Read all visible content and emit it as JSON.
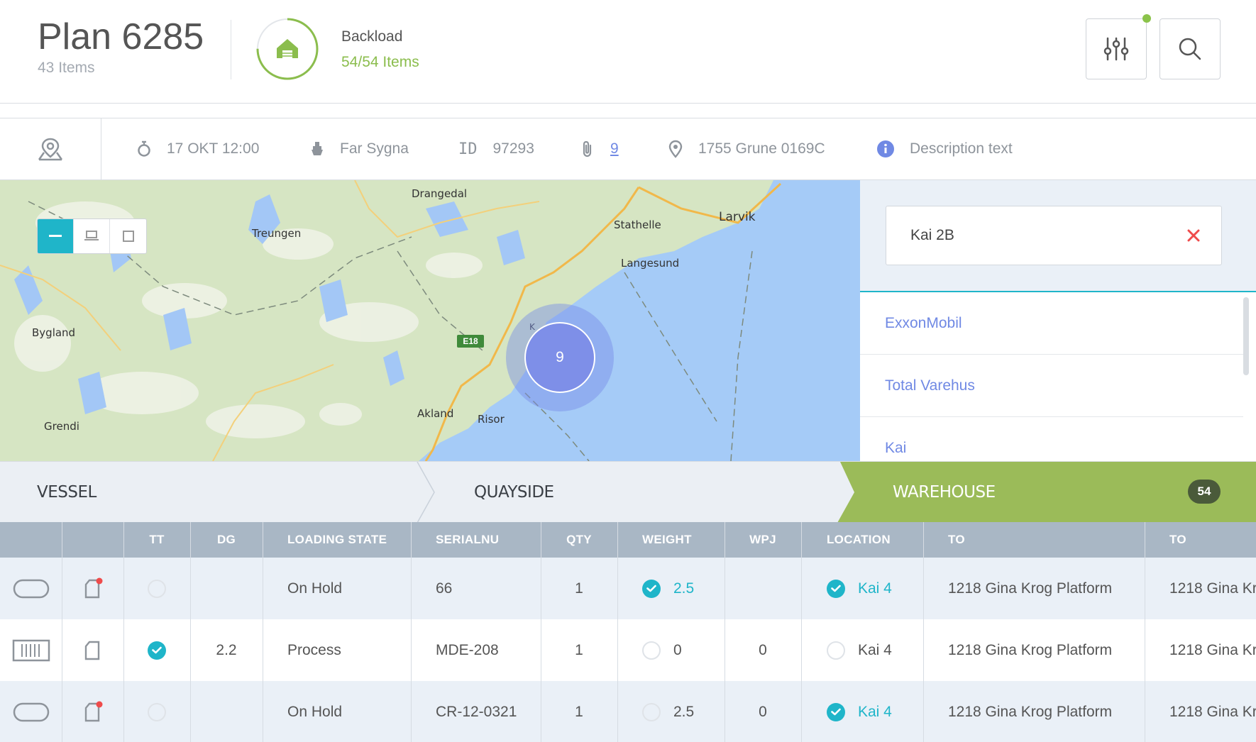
{
  "header": {
    "plan_title": "Plan 6285",
    "plan_items": "43 Items",
    "backload_title": "Backload",
    "backload_items": "54/54 Items",
    "backload_progress": 0.75
  },
  "infobar": {
    "datetime": "17 OKT 12:00",
    "vessel": "Far Sygna",
    "id_label": "ID",
    "id_value": "97293",
    "attachments": "9",
    "location": "1755 Grune 0169C",
    "description": "Description text"
  },
  "map": {
    "labels": {
      "drangedal": "Drangedal",
      "stathelle": "Stathelle",
      "larvik": "Larvik",
      "treungen": "Treungen",
      "langesund": "Langesund",
      "bygland": "Bygland",
      "grendi": "Grendi",
      "akland": "Akland",
      "risor": "Risor",
      "k": "K"
    },
    "road_badge": "E18",
    "cluster_count": "9"
  },
  "search_panel": {
    "input_value": "Kai 2B",
    "suggestions": [
      "ExxonMobil",
      "Total Varehus",
      "Kai"
    ]
  },
  "stages": {
    "vessel": "VESSEL",
    "quayside": "QUAYSIDE",
    "warehouse": "WAREHOUSE",
    "warehouse_count": "54",
    "colors": {
      "active": "#9bbb59",
      "inactive": "#ebeff4"
    }
  },
  "table": {
    "headers": {
      "tt": "TT",
      "dg": "DG",
      "loading_state": "LOADING STATE",
      "serial": "SERIALNU",
      "qty": "QTY",
      "weight": "WEIGHT",
      "wpj": "WPJ",
      "location": "LOCATION",
      "to1": "TO",
      "to2": "TO"
    },
    "rows": [
      {
        "type_icon": "tank-icon",
        "doc_flag": true,
        "tt": false,
        "dg": "",
        "loading_state": "On Hold",
        "serial": "66",
        "qty": "1",
        "weight_checked": true,
        "weight": "2.5",
        "wpj": "",
        "location_checked": true,
        "location": "Kai 4",
        "to1": "1218 Gina Krog Platform",
        "to2": "1218 Gina Kr"
      },
      {
        "type_icon": "container-icon",
        "doc_flag": false,
        "tt": true,
        "dg": "2.2",
        "loading_state": "Process",
        "serial": "MDE-208",
        "qty": "1",
        "weight_checked": false,
        "weight": "0",
        "wpj": "0",
        "location_checked": false,
        "location": "Kai 4",
        "to1": "1218 Gina Krog Platform",
        "to2": "1218 Gina Kr"
      },
      {
        "type_icon": "tank-icon",
        "doc_flag": true,
        "tt": false,
        "dg": "",
        "loading_state": "On Hold",
        "serial": "CR-12-0321",
        "qty": "1",
        "weight_checked": false,
        "weight": "2.5",
        "wpj": "0",
        "location_checked": true,
        "location": "Kai 4",
        "to1": "1218 Gina Krog Platform",
        "to2": "1218 Gina Kr"
      }
    ]
  },
  "colors": {
    "accent": "#1fb5c9",
    "link": "#7089e4",
    "success": "#8bbd4d",
    "header_row": "#a9b7c5"
  }
}
